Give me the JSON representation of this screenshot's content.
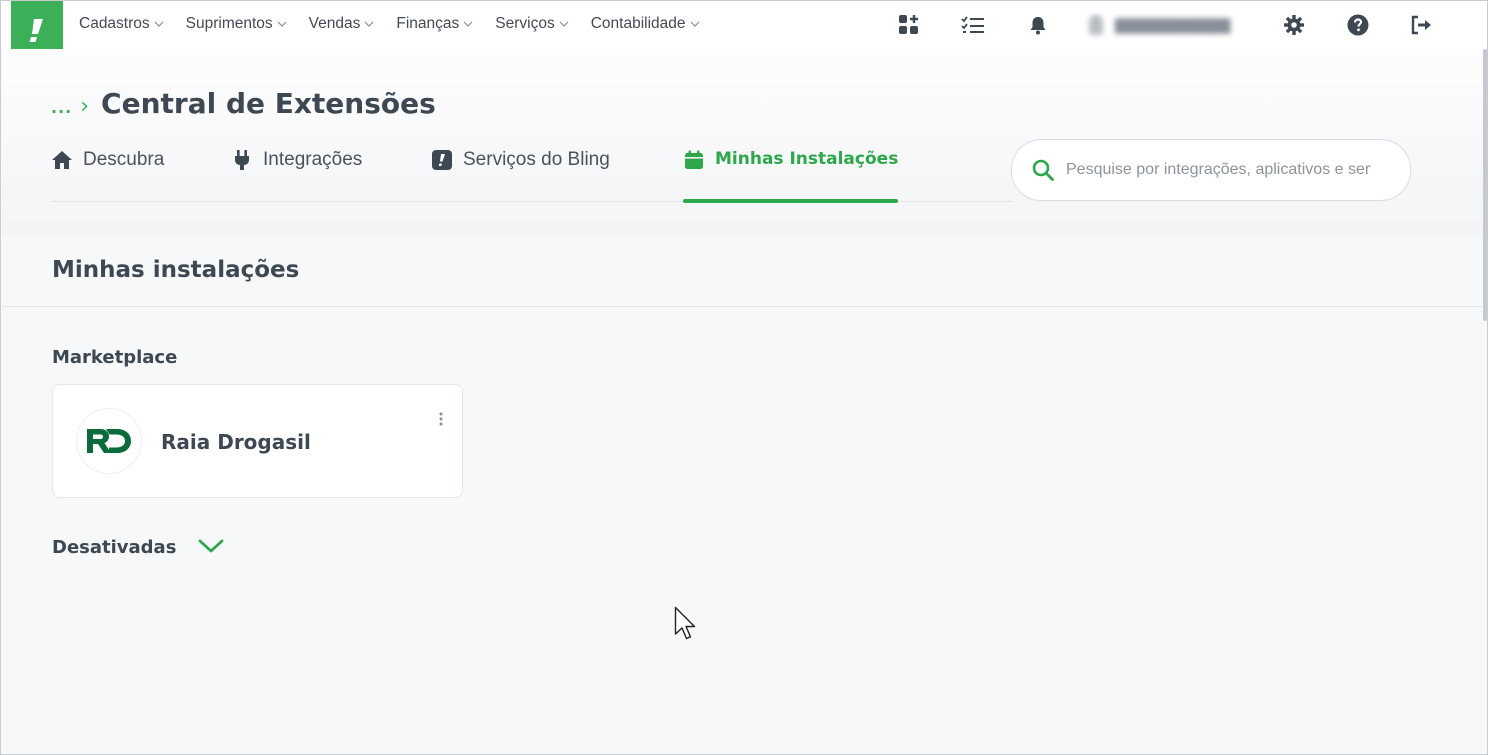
{
  "nav": {
    "logo_glyph": "!",
    "menu": [
      {
        "label": "Cadastros"
      },
      {
        "label": "Suprimentos"
      },
      {
        "label": "Vendas"
      },
      {
        "label": "Finanças"
      },
      {
        "label": "Serviços"
      },
      {
        "label": "Contabilidade"
      }
    ],
    "icons": [
      "apps-grid-icon",
      "checklist-icon",
      "bell-icon",
      "user-icon",
      "gear-icon",
      "help-icon",
      "logout-icon"
    ]
  },
  "breadcrumb": {
    "ellipsis": "...",
    "separator": "›"
  },
  "page_title": "Central de Extensões",
  "tabs": [
    {
      "label": "Descubra",
      "icon": "home-icon",
      "active": false
    },
    {
      "label": "Integrações",
      "icon": "plug-icon",
      "active": false
    },
    {
      "label": "Serviços do Bling",
      "icon": "bling-icon",
      "active": false
    },
    {
      "label": "Minhas Instalações",
      "icon": "calendar-icon",
      "active": true
    }
  ],
  "search": {
    "placeholder": "Pesquise por integrações, aplicativos e serviços"
  },
  "section_title": "Minhas instalações",
  "groups": {
    "marketplace": {
      "label": "Marketplace",
      "apps": [
        {
          "name": "Raia Drogasil",
          "logo_text": "RD"
        }
      ]
    },
    "deactivated": {
      "label": "Desativadas",
      "expanded": false
    }
  },
  "colors": {
    "accent": "#2ea64c",
    "logo_green": "#3cb058",
    "rd_green": "#0b6b3a",
    "text": "#3d4852"
  }
}
